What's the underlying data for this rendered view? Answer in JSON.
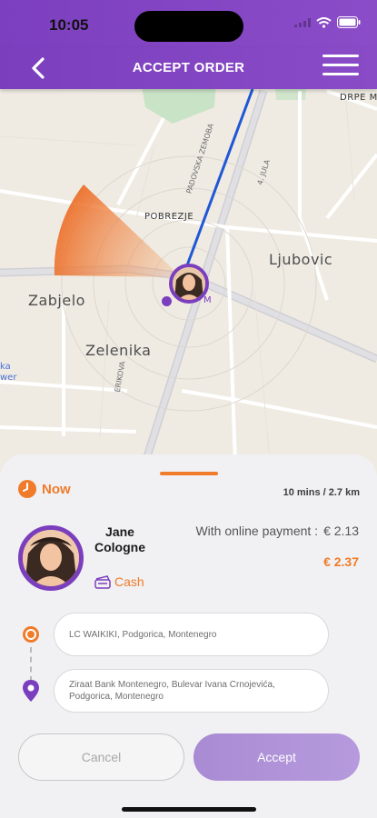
{
  "status_bar": {
    "time": "10:05"
  },
  "header": {
    "title": "ACCEPT ORDER",
    "back_icon": "chevron-left-icon",
    "menu_icon": "hamburger-icon"
  },
  "map": {
    "labels": {
      "ljubovic": "Ljubovic",
      "zabjelo": "Zabjelo",
      "zelenika": "Zelenika",
      "pobrezje": "POBREZJE",
      "drpe": "DRPE M",
      "street_1": "PADOVSKA ZEMOBA",
      "street_2": "4. JULA",
      "street_3": "ERIKOVA",
      "blue_1": "ka",
      "blue_2": "wer",
      "marker": "M"
    },
    "colors": {
      "route": "#1f57d6",
      "heading_cone": "#f07b2a"
    }
  },
  "order": {
    "time_label": "Now",
    "eta": "10 mins / 2.7 km",
    "customer": {
      "first_name": "Jane",
      "last_name": "Cologne"
    },
    "payment_method": "Cash",
    "online_payment_label": "With online payment :",
    "online_payment_value": "€ 2.13",
    "total": "€ 2.37",
    "pickup": "LC WAIKIKI, Podgorica, Montenegro",
    "dropoff": "Ziraat Bank Montenegro, Bulevar Ivana Crnojevića, Podgorica, Montenegro"
  },
  "actions": {
    "cancel": "Cancel",
    "accept": "Accept"
  },
  "colors": {
    "brand": "#7b3fbe",
    "accent": "#f07b2a",
    "accept_disabled": "#b39ad9"
  }
}
